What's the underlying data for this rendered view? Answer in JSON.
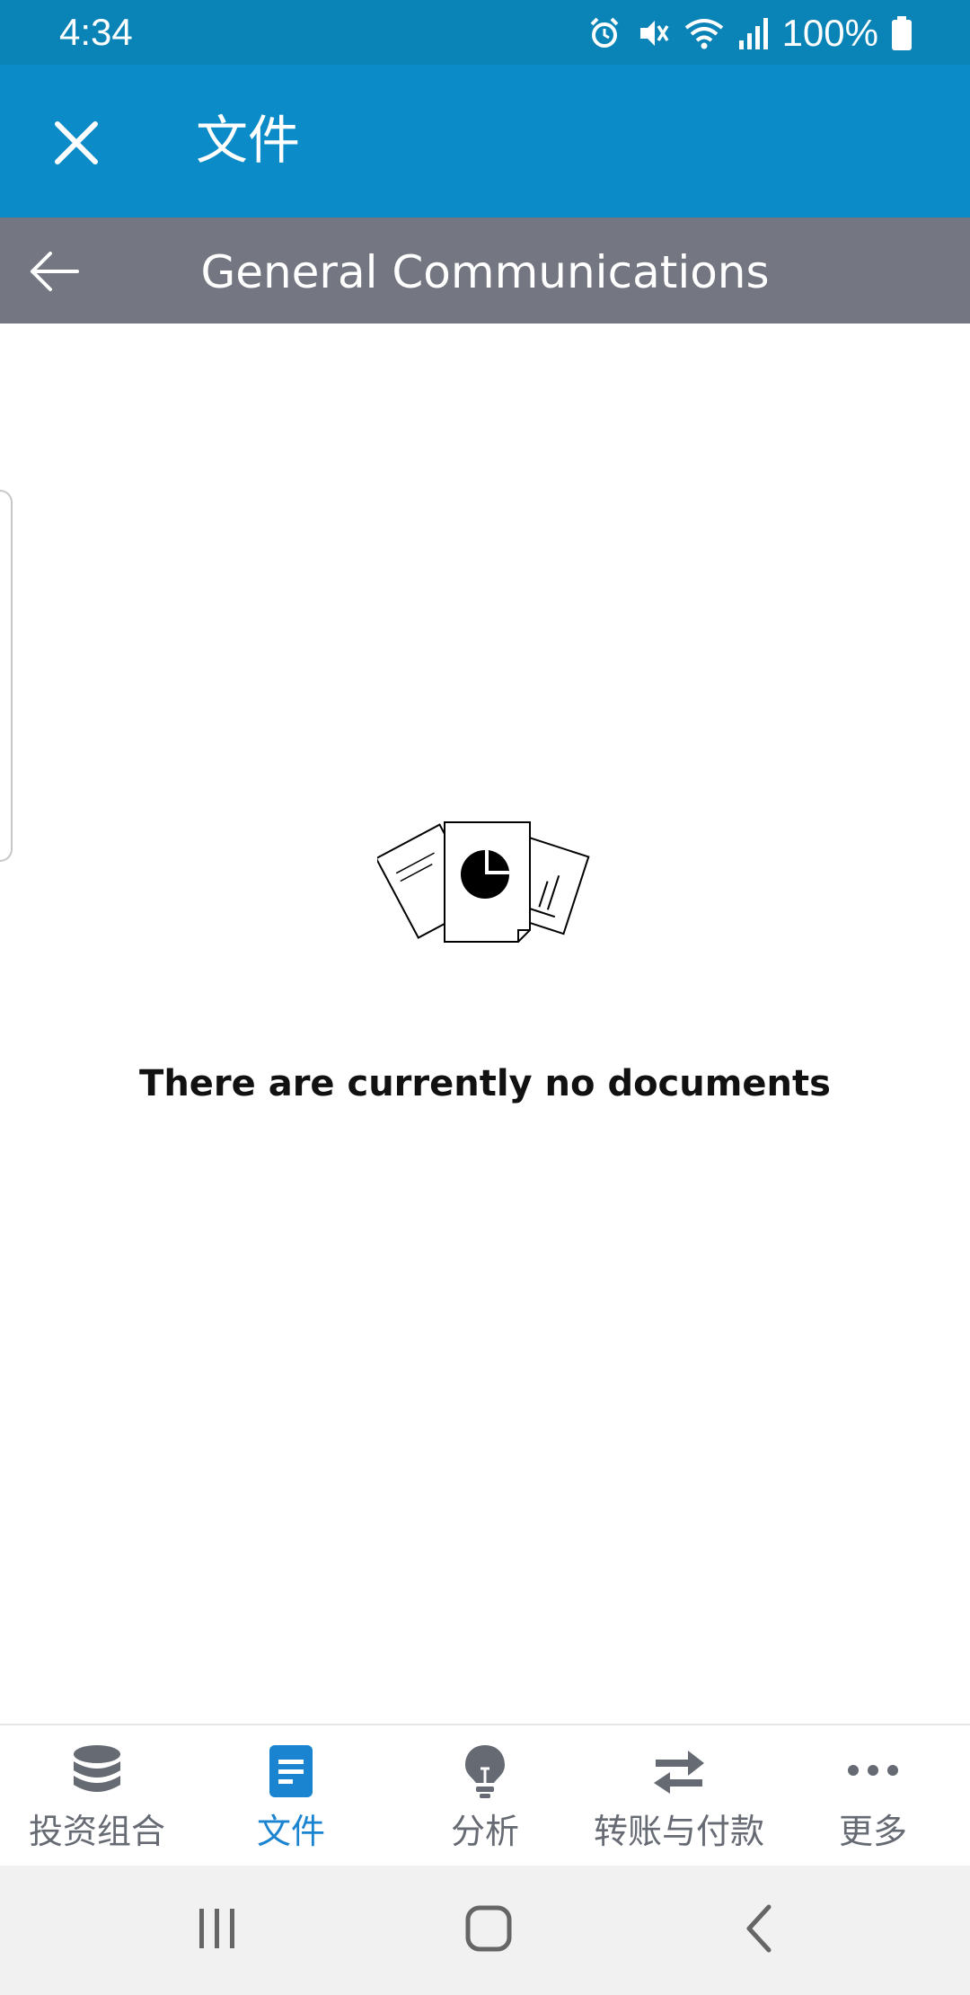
{
  "status_bar": {
    "time": "4:34",
    "battery": "100%",
    "icons": [
      "alarm-icon",
      "vibrate-mute-icon",
      "wifi-icon",
      "signal-icon",
      "battery-icon"
    ]
  },
  "app_bar": {
    "title": "文件",
    "close_icon": "close-icon",
    "background": "#0b8bc7"
  },
  "section_header": {
    "title": "General Communications",
    "back_icon": "arrow-left-icon",
    "background": "#747781"
  },
  "content": {
    "empty_message": "There are currently no documents",
    "illustration": "documents-illustration"
  },
  "bottom_nav": {
    "active_color": "#1a84d1",
    "inactive_color": "#666a73",
    "items": [
      {
        "label": "投资组合",
        "icon": "database-icon",
        "active": false
      },
      {
        "label": "文件",
        "icon": "document-icon",
        "active": true
      },
      {
        "label": "分析",
        "icon": "lightbulb-icon",
        "active": false
      },
      {
        "label": "转账与付款",
        "icon": "transfer-arrows-icon",
        "active": false
      },
      {
        "label": "更多",
        "icon": "more-dots-icon",
        "active": false
      }
    ]
  },
  "system_nav": {
    "buttons": [
      "recent-apps-icon",
      "home-icon",
      "back-icon"
    ]
  }
}
